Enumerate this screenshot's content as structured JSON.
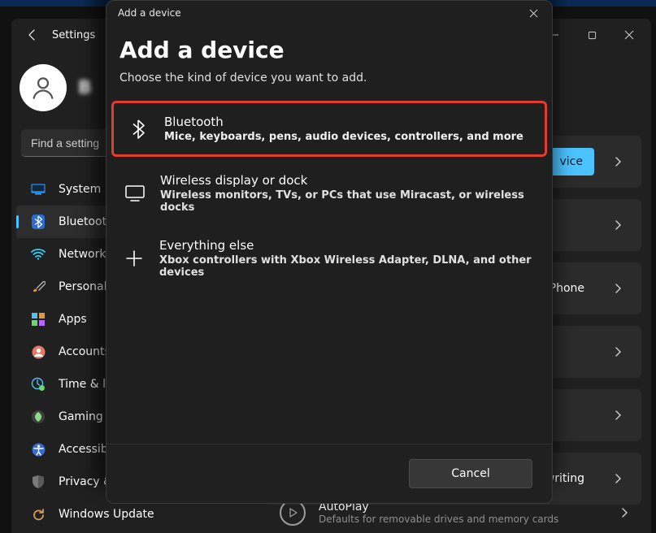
{
  "window": {
    "title": "Settings"
  },
  "profile": {
    "name_placeholder": "B"
  },
  "search": {
    "placeholder": "Find a setting"
  },
  "sidebar": {
    "items": [
      {
        "label": "System"
      },
      {
        "label": "Bluetooth & devices"
      },
      {
        "label": "Network & internet"
      },
      {
        "label": "Personalization"
      },
      {
        "label": "Apps"
      },
      {
        "label": "Accounts"
      },
      {
        "label": "Time & language"
      },
      {
        "label": "Gaming"
      },
      {
        "label": "Accessibility"
      },
      {
        "label": "Privacy & security"
      },
      {
        "label": "Windows Update"
      }
    ]
  },
  "main": {
    "add_button": "vice",
    "link_phone": "r Phone",
    "pen_tail": "andwriting",
    "autoplay_title": "AutoPlay",
    "autoplay_sub": "Defaults for removable drives and memory cards"
  },
  "dialog": {
    "titlebar": "Add a device",
    "title": "Add a device",
    "subtitle": "Choose the kind of device you want to add.",
    "options": [
      {
        "title": "Bluetooth",
        "desc": "Mice, keyboards, pens, audio devices, controllers, and more"
      },
      {
        "title": "Wireless display or dock",
        "desc": "Wireless monitors, TVs, or PCs that use Miracast, or wireless docks"
      },
      {
        "title": "Everything else",
        "desc": "Xbox controllers with Xbox Wireless Adapter, DLNA, and other devices"
      }
    ],
    "cancel": "Cancel"
  }
}
